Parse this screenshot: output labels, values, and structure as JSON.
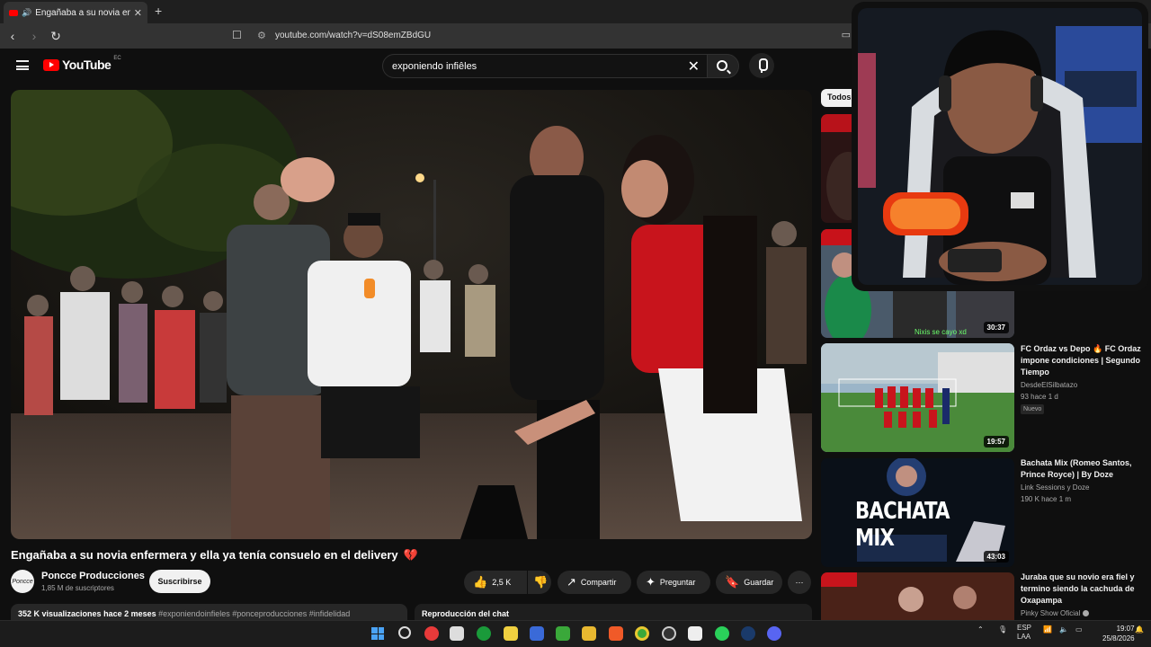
{
  "browser": {
    "tab_title": "Engañaba a su novia enfermera y",
    "tab_close": "✕",
    "new_tab": "+",
    "url": "youtube.com/watch?v=dS08emZBdGU"
  },
  "youtube": {
    "logo_text": "YouTube",
    "country_code": "EC",
    "search_query": "exponiendo infiêles",
    "search_clear": "✕"
  },
  "video": {
    "title": "Engañaba a su novia enfermera y ella ya tenía consuelo en el delivery",
    "title_emoji": "💔",
    "channel_avatar_text": "Poncce",
    "channel_name": "Poncce Producciones",
    "subscribers": "1,85 M de suscriptores",
    "subscribe_label": "Suscribirse",
    "likes": "2,5 K",
    "share_label": "Compartir",
    "ask_label": "Preguntar",
    "save_label": "Guardar",
    "more_label": "⋯",
    "views": "352 K visualizaciones",
    "age": "hace 2 meses",
    "hashtags": "#exponiendoinfieles #ponceproducciones #infidelidad",
    "chat_replay": "Reproducción del chat"
  },
  "sidebar": {
    "chip_all": "Todos",
    "recommendations": [
      {
        "title": "",
        "channel": "",
        "views": "",
        "age": "",
        "duration": "",
        "overlay_text": ""
      },
      {
        "title": "",
        "channel": "",
        "views": "",
        "age": "",
        "duration": "30:37",
        "overlay_text": "Nixis se cayo xd"
      },
      {
        "title": "FC Ordaz vs Depo 🔥 FC Ordaz impone condiciones | Segundo Tiempo",
        "channel": "DesdeElSilbatazo",
        "views": "93",
        "age": "hace 1 d",
        "badge": "Nuevo",
        "duration": "19:57"
      },
      {
        "title": "Bachata Mix (Romeo Santos, Prince Royce) | By Doze",
        "channel": "Link Sessions y Doze",
        "views": "190 K",
        "age": "hace 1 m",
        "duration": "43:03",
        "thumb_text": "BACHATA MIX"
      },
      {
        "title": "Juraba que su novio era fiel y termino siendo la cachuda de Oxapampa",
        "channel": "Pinky Show Oficial"
      }
    ]
  },
  "taskbar": {
    "lang_top": "ESP",
    "lang_bottom": "LAA",
    "time": "19:07",
    "date": "25/8/2026"
  },
  "colors": {
    "accent_red": "#ff0000",
    "background": "#0f0f0f",
    "pill": "#272727"
  }
}
